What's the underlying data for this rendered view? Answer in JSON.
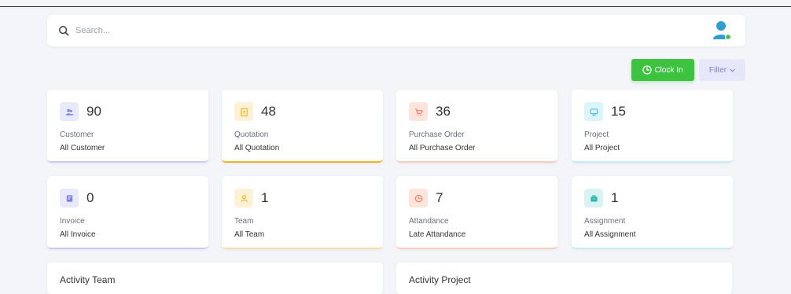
{
  "search": {
    "placeholder": "Search..."
  },
  "actions": {
    "clock_in": "Clock In",
    "filter": "Filter"
  },
  "colors": {
    "accent_green": "#3dc33f",
    "violet": "#7b7fe0",
    "amber": "#f0b429",
    "coral": "#f0826b",
    "cyan": "#46c6e3",
    "teal": "#2bb8b0"
  },
  "cards": [
    {
      "count": "90",
      "title": "Customer",
      "subtitle": "All Customer",
      "icon": "users-icon"
    },
    {
      "count": "48",
      "title": "Quotation",
      "subtitle": "All Quotation",
      "icon": "clipboard-icon"
    },
    {
      "count": "36",
      "title": "Purchase Order",
      "subtitle": "All Purchase Order",
      "icon": "cart-icon"
    },
    {
      "count": "15",
      "title": "Project",
      "subtitle": "All Project",
      "icon": "monitor-icon"
    },
    {
      "count": "0",
      "title": "Invoice",
      "subtitle": "All Invoice",
      "icon": "invoice-icon"
    },
    {
      "count": "1",
      "title": "Team",
      "subtitle": "All Team",
      "icon": "user-icon"
    },
    {
      "count": "7",
      "title": "Attandance",
      "subtitle": "Late Attandance",
      "icon": "clock-icon"
    },
    {
      "count": "1",
      "title": "Assignment",
      "subtitle": "All Assignment",
      "icon": "briefcase-icon"
    }
  ],
  "sections": {
    "activity_team": "Activity Team",
    "activity_project": "Activity Project"
  }
}
